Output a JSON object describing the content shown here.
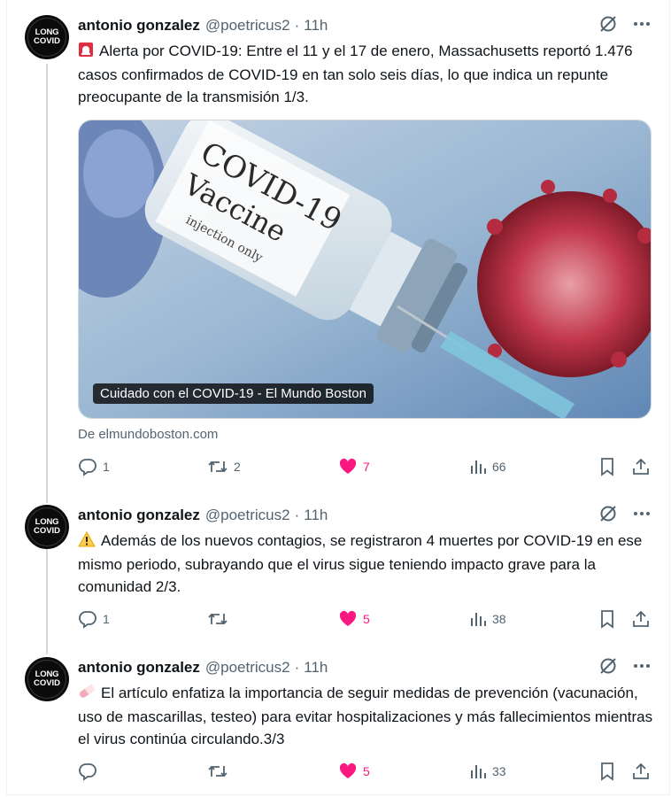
{
  "author": {
    "name": "antonio gonzalez",
    "handle": "@poetricus2",
    "time": "11h",
    "avatar_text_line1": "LONG",
    "avatar_text_line2": "COVID"
  },
  "tweets": [
    {
      "emoji": "rotating-light",
      "text": "Alerta por COVID-19: Entre el 11 y el 17 de enero, Massachusetts reportó 1.476 casos confirmados de COVID-19 en tan solo seis días, lo que indica un repunte preocupante de la transmisión 1/3.",
      "card": {
        "caption": "Cuidado con el COVID-19 - El Mundo Boston",
        "source": "De elmundoboston.com",
        "vial_label_1": "COVID-19",
        "vial_label_2": "Vaccine",
        "vial_label_3": "injection only"
      },
      "replies": "1",
      "reposts": "2",
      "likes": "7",
      "views": "66"
    },
    {
      "emoji": "warning",
      "text": "Además de los nuevos contagios, se registraron 4 muertes por COVID-19 en ese mismo periodo, subrayando que el virus sigue teniendo impacto grave para la comunidad 2/3.",
      "replies": "1",
      "reposts": "",
      "likes": "5",
      "views": "38"
    },
    {
      "emoji": "pill",
      "text": "El artículo enfatiza la importancia de seguir medidas de prevención (vacunación, uso de mascarillas, testeo) para evitar hospitalizaciones y más fallecimientos mientras el virus continúa circulando.3/3",
      "replies": "",
      "reposts": "",
      "likes": "5",
      "views": "33"
    }
  ],
  "colors": {
    "like": "#f91880",
    "muted": "#536471",
    "text": "#0f1419",
    "thread_line": "#cfd9de"
  }
}
